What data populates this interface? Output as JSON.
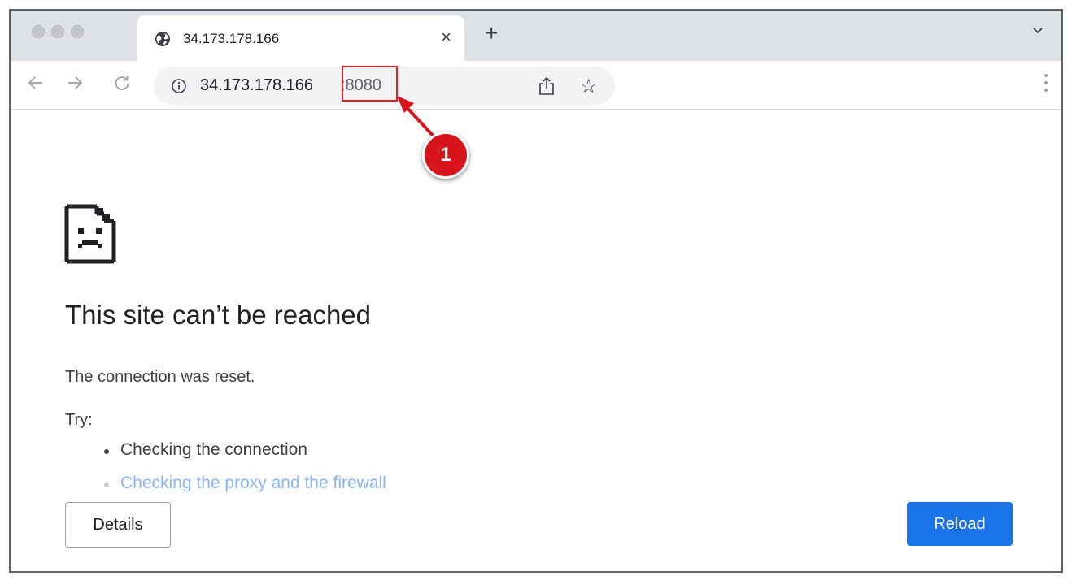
{
  "browser": {
    "tab": {
      "title": "34.173.178.166",
      "close_glyph": "×",
      "favicon": "globe-icon"
    },
    "new_tab_glyph": "+",
    "omnibox": {
      "host": "34.173.178.166",
      "port": ":8080"
    },
    "icons": [
      "back-arrow-icon",
      "forward-arrow-icon",
      "reload-icon",
      "info-icon",
      "share-icon",
      "star-icon",
      "kebab-menu-icon",
      "chevron-down-icon"
    ],
    "star_glyph": "☆"
  },
  "annotation": {
    "badge": "1",
    "color": "#d8141b"
  },
  "error_page": {
    "icon": "sad-page-icon",
    "heading": "This site can’t be reached",
    "description": "The connection was reset.",
    "try_label": "Try:",
    "suggestions": [
      "Checking the connection",
      "Checking the proxy and the firewall"
    ],
    "details_label": "Details",
    "reload_label": "Reload"
  },
  "colors": {
    "accent": "#1a73e8",
    "link_faded": "#8ab4f8",
    "tabstrip": "#dee1e6"
  }
}
